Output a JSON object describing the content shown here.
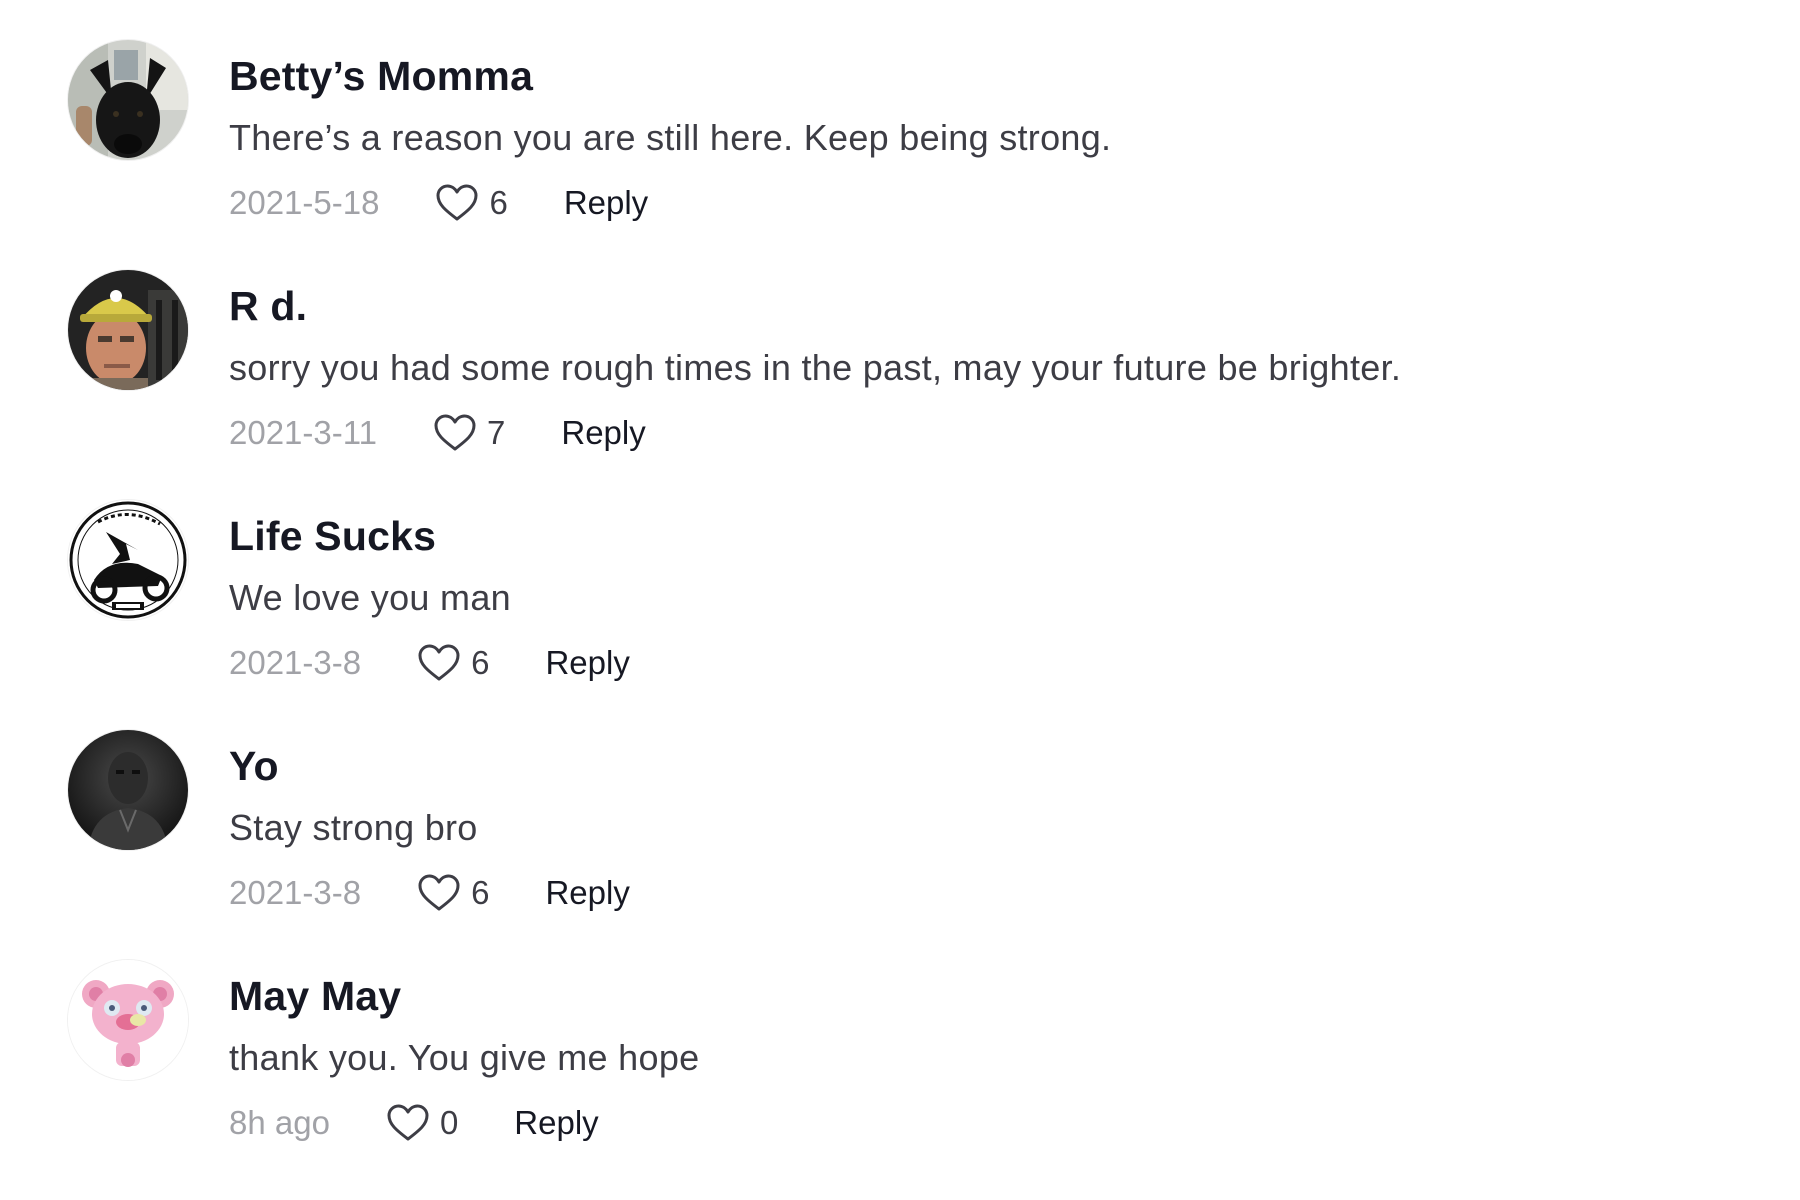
{
  "comments": [
    {
      "author": "Betty’s Momma",
      "text": "There’s a reason you are still here. Keep being strong.",
      "date": "2021-5-18",
      "likes": "6",
      "reply_label": "Reply",
      "avatar_icon": "avatar-black-dog"
    },
    {
      "author": "R d.",
      "text": "sorry you had some rough times in the past, may your future be brighter.",
      "date": "2021-3-11",
      "likes": "7",
      "reply_label": "Reply",
      "avatar_icon": "avatar-man-hardhat"
    },
    {
      "author": "Life Sucks",
      "text": "We love you man",
      "date": "2021-3-8",
      "likes": "6",
      "reply_label": "Reply",
      "avatar_icon": "avatar-motorcycle-logo"
    },
    {
      "author": "Yo",
      "text": "Stay strong bro",
      "date": "2021-3-8",
      "likes": "6",
      "reply_label": "Reply",
      "avatar_icon": "avatar-dark-portrait"
    },
    {
      "author": "May May",
      "text": "thank you. You give me hope",
      "date": "8h ago",
      "likes": "0",
      "reply_label": "Reply",
      "avatar_icon": "avatar-pink-bear"
    }
  ],
  "colors": {
    "name": "#161823",
    "text": "#3d3d45",
    "date": "#a1a2a7",
    "reply": "#161823"
  }
}
